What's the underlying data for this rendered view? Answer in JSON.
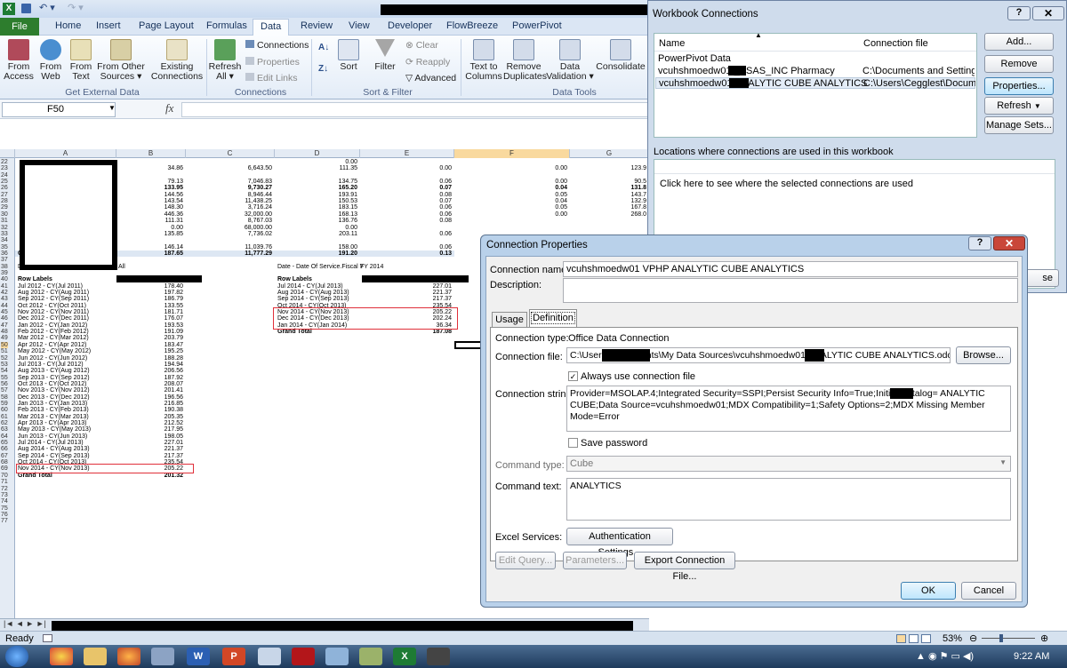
{
  "ribbon": {
    "file_tab": "File",
    "tabs": [
      "Home",
      "Insert",
      "Page Layout",
      "Formulas",
      "Data",
      "Review",
      "View",
      "Developer",
      "FlowBreeze",
      "PowerPivot"
    ],
    "get_external_data": {
      "group": "Get External Data",
      "from_access": "From\nAccess",
      "from_web": "From\nWeb",
      "from_text": "From\nText",
      "from_other": "From Other\nSources ▾",
      "existing": "Existing\nConnections"
    },
    "connections": {
      "group": "Connections",
      "refresh_all": "Refresh\nAll ▾",
      "connections": "Connections",
      "properties": "Properties",
      "edit_links": "Edit Links"
    },
    "sort_filter": {
      "group": "Sort & Filter",
      "sort": "Sort",
      "filter": "Filter",
      "clear": "Clear",
      "reapply": "Reapply",
      "advanced": "Advanced"
    },
    "data_tools": {
      "group": "Data Tools",
      "text_to_columns": "Text to\nColumns",
      "remove_duplicates": "Remove\nDuplicates",
      "data_validation": "Data\nValidation ▾",
      "consolidate": "Consolidate"
    }
  },
  "formula_bar": {
    "name_box": "F50",
    "fx": "fx"
  },
  "grid": {
    "columns": [
      "A",
      "B",
      "C",
      "D",
      "E",
      "F",
      "G"
    ],
    "rows_top": [
      {
        "n": "22",
        "b": "",
        "c": "",
        "d": "0.00",
        "e": "",
        "f": "",
        "g": ""
      },
      {
        "n": "23",
        "b": "34.86",
        "c": "6,643.50",
        "d": "111.35",
        "e": "0.00",
        "f": "0.00",
        "g": "123.9"
      },
      {
        "n": "24",
        "b": "",
        "c": "",
        "d": "",
        "e": "",
        "f": "",
        "g": ""
      },
      {
        "n": "25",
        "b": "79.13",
        "c": "7,046.83",
        "d": "134.75",
        "e": "0.06",
        "f": "0.00",
        "g": "90.5"
      },
      {
        "n": "26",
        "b": "133.95",
        "c": "9,730.27",
        "d": "165.20",
        "e": "0.07",
        "f": "0.04",
        "g": "131.8"
      },
      {
        "n": "27",
        "b": "144.56",
        "c": "8,946.44",
        "d": "193.91",
        "e": "0.08",
        "f": "0.05",
        "g": "143.7"
      },
      {
        "n": "28",
        "b": "143.54",
        "c": "11,438.25",
        "d": "150.53",
        "e": "0.07",
        "f": "0.04",
        "g": "132.9"
      },
      {
        "n": "29",
        "b": "148.30",
        "c": "3,716.24",
        "d": "183.15",
        "e": "0.06",
        "f": "0.05",
        "g": "167.8"
      },
      {
        "n": "30",
        "b": "446.36",
        "c": "32,000.00",
        "d": "168.13",
        "e": "0.06",
        "f": "0.00",
        "g": "268.0"
      },
      {
        "n": "31",
        "b": "111.31",
        "c": "8,767.03",
        "d": "136.76",
        "e": "0.08",
        "f": "",
        "g": ""
      },
      {
        "n": "32",
        "b": "0.00",
        "c": "68,000.00",
        "d": "0.00",
        "e": "",
        "f": "",
        "g": ""
      },
      {
        "n": "33",
        "b": "135.85",
        "c": "7,736.02",
        "d": "203.11",
        "e": "0.06",
        "f": "",
        "g": ""
      },
      {
        "n": "34",
        "b": "",
        "c": "",
        "d": "",
        "e": "",
        "f": "",
        "g": ""
      },
      {
        "n": "35",
        "b": "146.14",
        "c": "11,039.76",
        "d": "158.00",
        "e": "0.06",
        "f": "",
        "g": ""
      }
    ],
    "grand_total_top": {
      "n": "36",
      "label": "Grand Total",
      "b": "187.65",
      "c": "11,777.29",
      "d": "191.20",
      "e": "0.13"
    },
    "filter_left_label": "Date - Date Of Service.Fiscal Year",
    "filter_left_value": "All",
    "filter_right_label": "Date - Date Of Service.Fiscal Y",
    "filter_right_value": "FY 2014",
    "row_labels": "Row Labels",
    "left_pivot": [
      [
        "Jul 2012 - CY(Jul 2011)",
        "178.40"
      ],
      [
        "Aug 2012 - CY(Aug 2011)",
        "197.82"
      ],
      [
        "Sep 2012 - CY(Sep 2011)",
        "186.79"
      ],
      [
        "Oct 2012 - CY(Oct 2011)",
        "133.55"
      ],
      [
        "Nov 2012 - CY(Nov 2011)",
        "181.71"
      ],
      [
        "Dec 2012 - CY(Dec 2011)",
        "176.07"
      ],
      [
        "Jan 2012 - CY(Jan 2012)",
        "193.53"
      ],
      [
        "Feb 2012 - CY(Feb 2012)",
        "191.09"
      ],
      [
        "Mar 2012 - CY(Mar 2012)",
        "203.79"
      ],
      [
        "Apr 2012 - CY(Apr 2012)",
        "183.47"
      ],
      [
        "May 2012 - CY(May 2012)",
        "195.25"
      ],
      [
        "Jun 2012 - CY(Jun 2012)",
        "188.28"
      ],
      [
        "Jul 2013 - CY(Jul 2012)",
        "194.94"
      ],
      [
        "Aug 2013 - CY(Aug 2012)",
        "206.56"
      ],
      [
        "Sep 2013 - CY(Sep 2012)",
        "187.92"
      ],
      [
        "Oct 2013 - CY(Oct 2012)",
        "208.07"
      ],
      [
        "Nov 2013 - CY(Nov 2012)",
        "201.41"
      ],
      [
        "Dec 2013 - CY(Dec 2012)",
        "196.56"
      ],
      [
        "Jan 2013 - CY(Jan 2013)",
        "216.85"
      ],
      [
        "Feb 2013 - CY(Feb 2013)",
        "190.38"
      ],
      [
        "Mar 2013 - CY(Mar 2013)",
        "205.35"
      ],
      [
        "Apr 2013 - CY(Apr 2013)",
        "212.52"
      ],
      [
        "May 2013 - CY(May 2013)",
        "217.95"
      ],
      [
        "Jun 2013 - CY(Jun 2013)",
        "198.05"
      ],
      [
        "Jul 2014 - CY(Jul 2013)",
        "227.01"
      ],
      [
        "Aug 2014 - CY(Aug 2013)",
        "221.37"
      ],
      [
        "Sep 2014 - CY(Sep 2013)",
        "217.37"
      ],
      [
        "Oct 2014 - CY(Oct 2013)",
        "235.54"
      ],
      [
        "Nov 2014 - CY(Nov 2013)",
        "205.22"
      ]
    ],
    "left_grand_total": [
      "Grand Total",
      "201.32"
    ],
    "right_pivot": [
      [
        "Jul 2014 - CY(Jul 2013)",
        "227.01"
      ],
      [
        "Aug 2014 - CY(Aug 2013)",
        "221.37"
      ],
      [
        "Sep 2014 - CY(Sep 2013)",
        "217.37"
      ],
      [
        "Oct 2014 - CY(Oct 2013)",
        "235.54"
      ],
      [
        "Nov 2014 - CY(Nov 2013)",
        "205.22"
      ],
      [
        "Dec 2014 - CY(Dec 2013)",
        "202.24"
      ],
      [
        "Jan 2014 - CY(Jan 2014)",
        "36.34"
      ]
    ],
    "right_grand_total": [
      "Grand Total",
      "187.08"
    ]
  },
  "status": {
    "ready": "Ready",
    "zoom": "53%",
    "time": "9:22 AM"
  },
  "workbook_connections": {
    "title": "Workbook Connections",
    "col_name": "Name",
    "col_file": "Connection file",
    "rows": [
      {
        "name": "PowerPivot Data",
        "file": ""
      },
      {
        "name": "vcuhshmoedw01 _SSAS_INC Pharmacy",
        "file": "C:\\Documents and Settings\\jhar"
      },
      {
        "name": "vcuhshmoedw01 ANALYTIC CUBE ANALYTICS",
        "file": "C:\\Users\\Cegglest\\Documents\\M"
      }
    ],
    "buttons": [
      "Add...",
      "Remove",
      "Properties...",
      "Refresh",
      "Manage Sets..."
    ],
    "locations_label": "Locations where connections are used in this workbook",
    "locations_hint": "Click here to see where the selected connections are used",
    "close_partial": "se"
  },
  "connection_properties": {
    "title": "Connection Properties",
    "name_label": "Connection name:",
    "name_value": "vcuhshmoedw01 VPHP ANALYTIC CUBE ANALYTICS",
    "description_label": "Description:",
    "tabs": [
      "Usage",
      "Definition"
    ],
    "type_label": "Connection type:",
    "type_value": "Office Data Connection",
    "file_label": "Connection file:",
    "file_value": "C:\\Users\\            Documents\\My Data Sources\\vcuhshmoedw01            ANALYTIC CUBE ANALYTICS.odc",
    "browse": "Browse...",
    "always_use": "Always use connection file",
    "string_label": "Connection string:",
    "string_value": "Provider=MSOLAP.4;Integrated Security=SSPI;Persist Security Info=True;Initial Catalog=           ANALYTIC CUBE;Data Source=vcuhshmoedw01;MDX Compatibility=1;Safety Options=2;MDX Missing Member Mode=Error",
    "save_password": "Save password",
    "command_type_label": "Command type:",
    "command_type_value": "Cube",
    "command_text_label": "Command text:",
    "command_text_value": "ANALYTICS",
    "excel_services_label": "Excel Services:",
    "auth_settings": "Authentication Settings...",
    "edit_query": "Edit Query...",
    "parameters": "Parameters...",
    "export": "Export Connection File...",
    "ok": "OK",
    "cancel": "Cancel"
  }
}
